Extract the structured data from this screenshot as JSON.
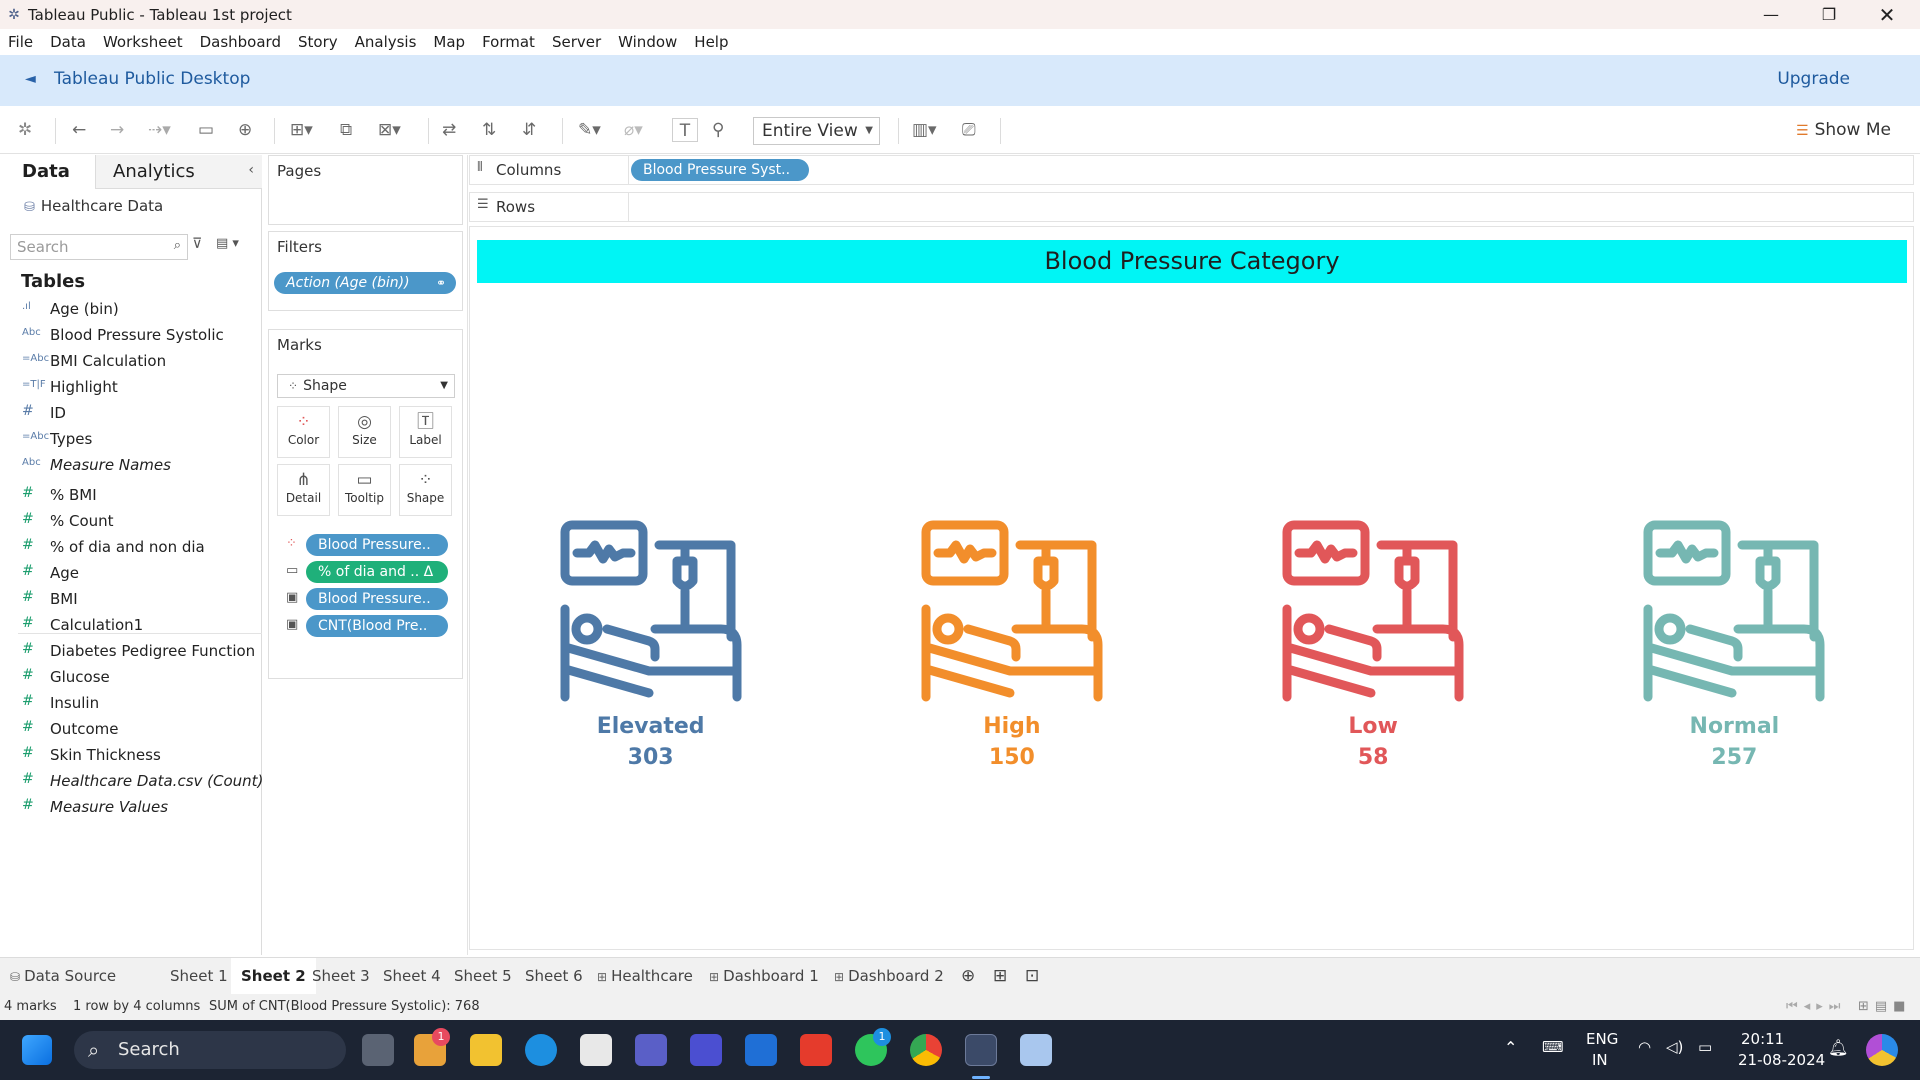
{
  "window": {
    "title": "Tableau Public - Tableau 1st project"
  },
  "menu": [
    "File",
    "Data",
    "Worksheet",
    "Dashboard",
    "Story",
    "Analysis",
    "Map",
    "Format",
    "Server",
    "Window",
    "Help"
  ],
  "banner": {
    "title": "Tableau Public Desktop",
    "upgrade": "Upgrade"
  },
  "toolbar": {
    "fit": "Entire View",
    "show_me": "Show Me"
  },
  "data_pane": {
    "tab_data": "Data",
    "tab_analytics": "Analytics",
    "source": "Healthcare Data",
    "search_placeholder": "Search",
    "tables_heading": "Tables",
    "dimensions": [
      {
        "icon": "bin-icon",
        "name": "Age (bin)",
        "italic": false
      },
      {
        "icon": "abc-icon",
        "name": "Blood Pressure Systolic",
        "italic": false
      },
      {
        "icon": "calc-abc-icon",
        "name": "BMI Calculation",
        "italic": false
      },
      {
        "icon": "calc-tf-icon",
        "name": "Highlight",
        "italic": false
      },
      {
        "icon": "number-icon",
        "name": "ID",
        "italic": false
      },
      {
        "icon": "calc-abc-icon",
        "name": "Types",
        "italic": false
      },
      {
        "icon": "abc-icon",
        "name": "Measure Names",
        "italic": true
      }
    ],
    "measures": [
      {
        "name": "% BMI",
        "italic": false
      },
      {
        "name": "% Count",
        "italic": false
      },
      {
        "name": "% of dia and non dia",
        "italic": false
      },
      {
        "name": "Age",
        "italic": false
      },
      {
        "name": "BMI",
        "italic": false
      },
      {
        "name": "Calculation1",
        "italic": false
      },
      {
        "name": "Diabetes Pedigree Function",
        "italic": false
      },
      {
        "name": "Glucose",
        "italic": false
      },
      {
        "name": "Insulin",
        "italic": false
      },
      {
        "name": "Outcome",
        "italic": false
      },
      {
        "name": "Skin Thickness",
        "italic": false
      },
      {
        "name": "Healthcare Data.csv (Count)",
        "italic": true
      },
      {
        "name": "Measure Values",
        "italic": true
      }
    ]
  },
  "shelves": {
    "pages": "Pages",
    "filters": "Filters",
    "filter_pill": "Action (Age (bin))",
    "marks": "Marks",
    "mark_type": "Shape",
    "mark_buttons": [
      "Color",
      "Size",
      "Label",
      "Detail",
      "Tooltip",
      "Shape"
    ],
    "mark_fields": [
      {
        "icon": "color-dots-icon",
        "label": "Blood Pressure..",
        "color": "blue"
      },
      {
        "icon": "tooltip-icon",
        "label": "% of dia and .. Δ",
        "color": "green"
      },
      {
        "icon": "label-icon",
        "label": "Blood Pressure..",
        "color": "blue"
      },
      {
        "icon": "label-icon",
        "label": "CNT(Blood Pre..",
        "color": "blue"
      }
    ],
    "columns_label": "Columns",
    "columns_pill": "Blood Pressure Syst..",
    "rows_label": "Rows"
  },
  "chart_data": {
    "type": "table",
    "title": "Blood Pressure Category",
    "mark": "hospital-bed-icon",
    "categories": [
      "Elevated",
      "High",
      "Low",
      "Normal"
    ],
    "values": [
      303,
      150,
      58,
      257
    ],
    "colors": [
      "#4e79a7",
      "#f28e2b",
      "#e15759",
      "#76b7b2"
    ]
  },
  "sheet_tabs": [
    "Data Source",
    "Sheet 1",
    "Sheet 2",
    "Sheet 3",
    "Sheet 4",
    "Sheet 5",
    "Sheet 6",
    "Healthcare",
    "Dashboard 1",
    "Dashboard 2"
  ],
  "active_sheet": "Sheet 2",
  "status": {
    "marks": "4 marks",
    "layout": "1 row by 4 columns",
    "sum": "SUM of CNT(Blood Pressure Systolic): 768"
  },
  "taskbar": {
    "search": "Search",
    "lang": "ENG",
    "region": "IN",
    "time": "20:11",
    "date": "21-08-2024",
    "badge_1": "1",
    "badge_2": "1"
  }
}
